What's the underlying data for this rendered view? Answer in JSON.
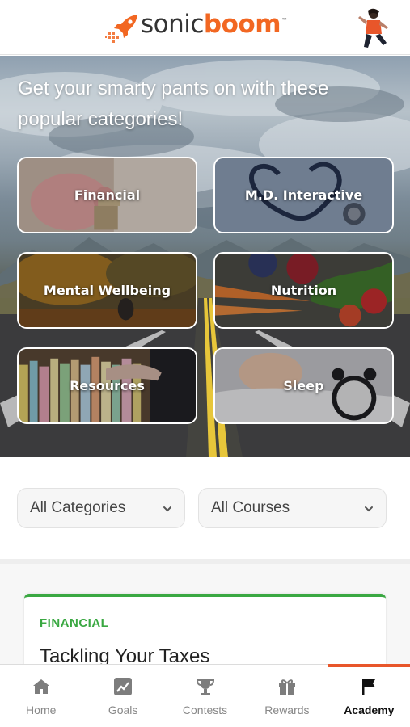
{
  "header": {
    "brand_part1": "sonic",
    "brand_part2": "boom",
    "trademark": "™",
    "logo_icon": "rocket-icon",
    "avatar_icon": "user-avatar"
  },
  "hero": {
    "title": "Get your smarty pants on with these popular categories!",
    "categories": [
      {
        "label": "Financial",
        "image": "piggy-bank"
      },
      {
        "label": "M.D. Interactive",
        "image": "stethoscope-heart"
      },
      {
        "label": "Mental Wellbeing",
        "image": "person-autumn-forest"
      },
      {
        "label": "Nutrition",
        "image": "vegetables"
      },
      {
        "label": "Resources",
        "image": "file-folders"
      },
      {
        "label": "Sleep",
        "image": "sleeping-child-alarm-clock"
      }
    ]
  },
  "filters": {
    "category_select": "All Categories",
    "course_select": "All Courses"
  },
  "course": {
    "category": "FINANCIAL",
    "title": "Tackling Your Taxes"
  },
  "nav": {
    "items": [
      {
        "label": "Home",
        "icon": "home-icon"
      },
      {
        "label": "Goals",
        "icon": "chart-icon"
      },
      {
        "label": "Contests",
        "icon": "trophy-icon"
      },
      {
        "label": "Rewards",
        "icon": "gift-icon"
      },
      {
        "label": "Academy",
        "icon": "flag-icon"
      }
    ],
    "active": "Academy"
  },
  "colors": {
    "brand_orange": "#f26722",
    "active_accent": "#e8562a",
    "category_green": "#3aa842",
    "nav_inactive": "#888888"
  }
}
